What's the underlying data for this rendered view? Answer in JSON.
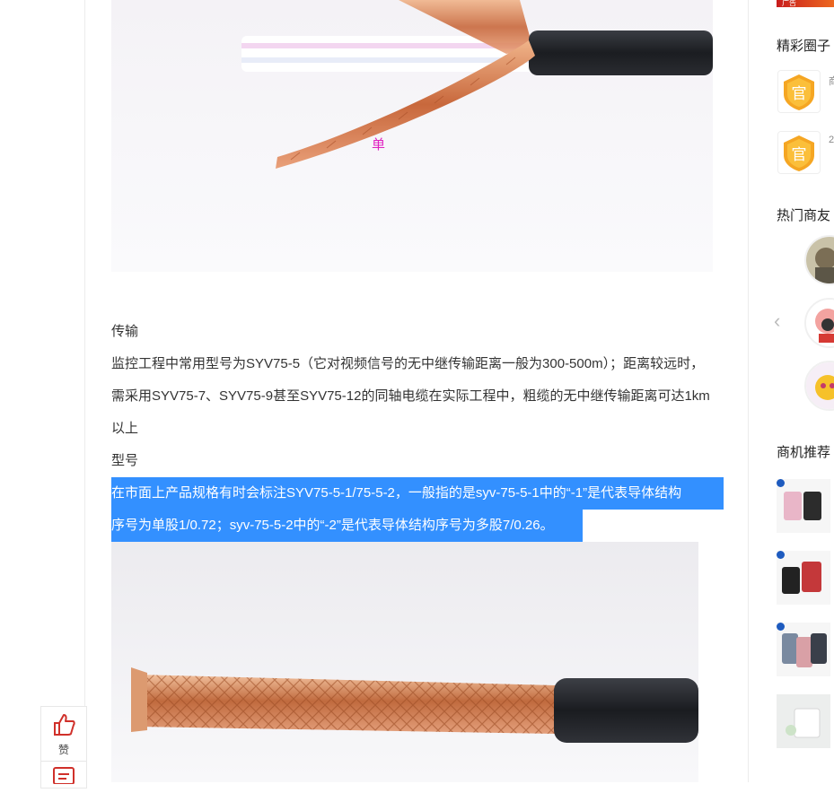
{
  "article": {
    "image1_overlay_text": "单",
    "heading_transmission": "传输",
    "paragraph_transmission": "监控工程中常用型号为SYV75-5（它对视频信号的无中继传输距离一般为300-500m）；距离较远时，需采用SYV75-7、SYV75-9甚至SYV75-12的同轴电缆在实际工程中，粗缆的无中继传输距离可达1km以上",
    "heading_model": "型号",
    "selected_line1": "在市面上产品规格有时会标注SYV75-5-1/75-5-2，一般指的是syv-75-5-1中的“-1”是代表导体结构",
    "selected_line2": "序号为单股1/0.72；syv-75-5-2中的“-2”是代表导体结构序号为多股7/0.26。"
  },
  "float_bar": {
    "like_label": "赞"
  },
  "right_column": {
    "banner_text": "广告",
    "circles_title": "精彩圈子",
    "circle_items": [
      {
        "badge_text": "官",
        "meta": "商"
      },
      {
        "badge_text": "官",
        "meta": "2"
      }
    ],
    "hot_friends_title": "热门商友",
    "opportunity_title": "商机推荐"
  },
  "colors": {
    "selection": "#3390ff",
    "overlay_text": "#e020c0",
    "badge_orange": "#f5a623"
  }
}
